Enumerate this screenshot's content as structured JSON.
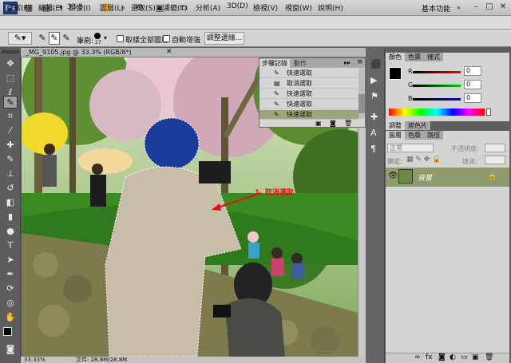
{
  "app": {
    "logo": "Ps",
    "zoom": "33.3",
    "workspace": "基本功能",
    "window_controls": [
      "–",
      "□",
      "✕"
    ]
  },
  "menu": [
    "檔案(F)",
    "編輯(E)",
    "影像(I)",
    "圖層(L)",
    "選取(S)",
    "濾鏡(T)",
    "分析(A)",
    "3D(D)",
    "檢視(V)",
    "視窗(W)",
    "說明(H)"
  ],
  "options": {
    "brush_label": "筆刷:",
    "brush_size": "27",
    "sample_all_label": "取樣全部圖層",
    "auto_enhance_label": "自動增強",
    "refine_edge_button": "調整邊緣..."
  },
  "document": {
    "title": "_MG_9105.jpg @ 33.3% (RGB/8*)",
    "status_zoom": "33.33%",
    "status_doc": "文件: 28.8M/28.8M",
    "annotation": "1. 取消選取"
  },
  "history": {
    "tabs": [
      "步驟記錄",
      "動作"
    ],
    "items": [
      "快速選取",
      "取消選取",
      "快速選取",
      "快速選取",
      "快速選取"
    ],
    "selected_index": 4
  },
  "color_panel": {
    "tabs": [
      "顏色",
      "色票",
      "樣式"
    ],
    "channels": [
      {
        "label": "R",
        "value": "0"
      },
      {
        "label": "G",
        "value": "0"
      },
      {
        "label": "B",
        "value": "0"
      }
    ]
  },
  "adjust_tabs": [
    "調整",
    "遮色片"
  ],
  "layers_panel": {
    "tabs": [
      "圖層",
      "色版",
      "路徑"
    ],
    "blend_mode": "正常",
    "opacity_label": "不透明度:",
    "lock_label": "鎖定:",
    "fill_label": "填滿:",
    "layer_name": "背景"
  },
  "colors": {
    "accent": "#8e9b6d",
    "selected_row": "#9aa77a"
  }
}
